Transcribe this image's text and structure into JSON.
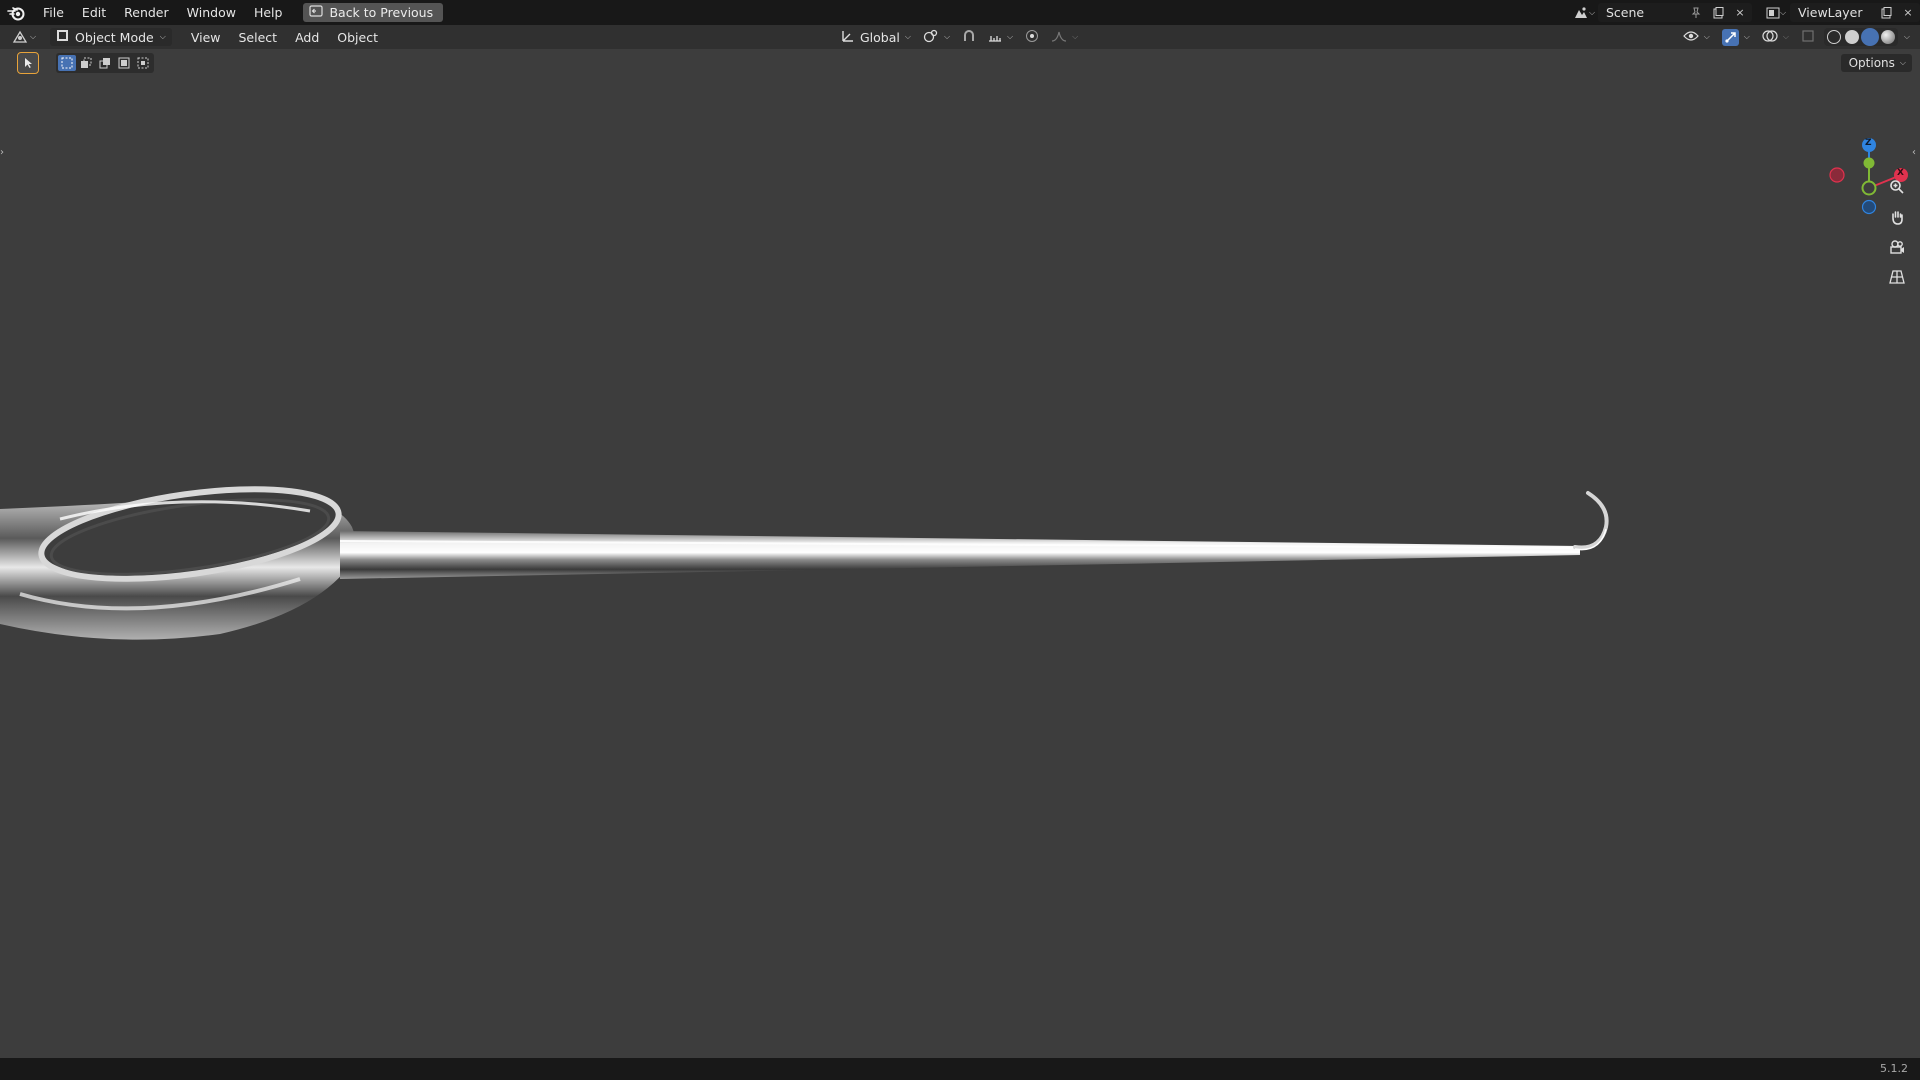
{
  "topbar": {
    "menu": [
      "File",
      "Edit",
      "Render",
      "Window",
      "Help"
    ],
    "back_button": "Back to Previous",
    "scene": "Scene",
    "view_layer": "ViewLayer"
  },
  "header": {
    "mode": "Object Mode",
    "menus": [
      "View",
      "Select",
      "Add",
      "Object"
    ],
    "orientation": "Global"
  },
  "tool_settings": {
    "options_label": "Options"
  },
  "gizmo": {
    "x_label": "X",
    "z_label": "Z"
  },
  "statusbar": {
    "version": "5.1.2"
  },
  "colors": {
    "viewport_bg": "#3d3d3d",
    "topbar_bg": "#181818",
    "header_bg": "#303030",
    "accent": "#4772b3",
    "axis_x": "#e0324e",
    "axis_y": "#80b935",
    "axis_z": "#2f84e0"
  },
  "icons": [
    "blender-logo-icon",
    "back-icon",
    "editor-type-icon",
    "object-mode-icon",
    "transform-orientation-icon",
    "pivot-icon",
    "snap-icon",
    "proportional-editing-icon",
    "select-tool-icon",
    "zoom-icon",
    "pan-hand-icon",
    "camera-view-icon",
    "grid-perspective-icon"
  ]
}
